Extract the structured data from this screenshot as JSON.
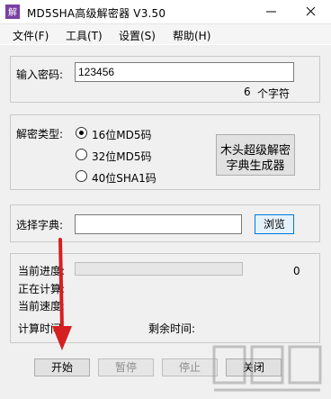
{
  "window": {
    "title": "MD5SHA高级解密器 V3.50"
  },
  "menu": {
    "items": [
      "文件(F)",
      "工具(T)",
      "设置(S)",
      "帮助(H)"
    ]
  },
  "password": {
    "label": "输入密码:",
    "value": "123456",
    "char_count": "6",
    "char_count_unit": "个字符"
  },
  "decrypt_type": {
    "label": "解密类型:",
    "options": [
      "16位MD5码",
      "32位MD5码",
      "40位SHA1码"
    ],
    "selected_index": 0,
    "generator_button": [
      "木头超级解密",
      "字典生成器"
    ]
  },
  "dictionary": {
    "label": "选择字典:",
    "value": "",
    "browse_label": "浏览"
  },
  "progress": {
    "current_label": "当前进度:",
    "computing_label": "正在计算:",
    "speed_label": "当前速度:",
    "calc_time_label": "计算时间:",
    "remaining_label": "剩余时间:",
    "value": "0",
    "fraction": 0
  },
  "actions": {
    "start": "开始",
    "pause": "暂停",
    "stop": "停止",
    "close": "关闭"
  },
  "colors": {
    "accent_border": "#0078d7",
    "arrow": "#d61f1f",
    "progress_fill": "#06b025"
  },
  "icons": {
    "app": "app-icon",
    "minimize": "minimize-icon",
    "close": "close-icon",
    "annotation": "red-arrow-icon"
  }
}
